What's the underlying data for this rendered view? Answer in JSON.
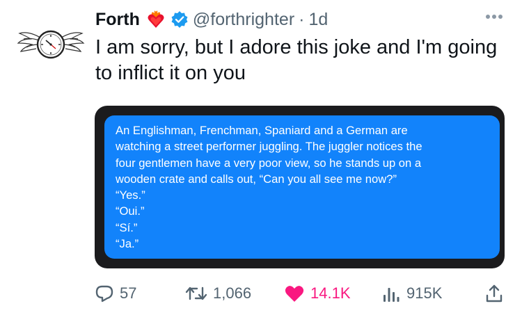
{
  "tweet": {
    "author_name": "Forth",
    "handle": "@forthrighter",
    "separator": "·",
    "time": "1d",
    "text": "I am sorry, but I adore this joke and I'm going to inflict it on you"
  },
  "media": {
    "message_lines": [
      "An Englishman, Frenchman, Spaniard and a German are",
      "watching a street performer juggling. The juggler notices the",
      "four gentlemen have a very poor view, so he stands up on a",
      "wooden crate and calls out, “Can you all see me now?”",
      "“Yes.”",
      "“Oui.”",
      "“Sí.”",
      "“Ja.”"
    ],
    "bubble_color": "#1283fb",
    "background_color": "#1b1b1d"
  },
  "actions": {
    "replies": "57",
    "reposts": "1,066",
    "likes": "14.1K",
    "views": "915K"
  },
  "icons": {
    "avatar": "winged-clock-avatar",
    "emoji": "heart-on-fire-icon",
    "verified": "verified-badge-icon",
    "more": "more-options-icon",
    "reply": "reply-icon",
    "repost": "repost-icon",
    "like": "like-heart-icon",
    "views": "views-icon",
    "share": "share-icon"
  },
  "colors": {
    "like_active": "#f91880",
    "verified": "#1d9bf0",
    "muted_text": "#536471"
  }
}
